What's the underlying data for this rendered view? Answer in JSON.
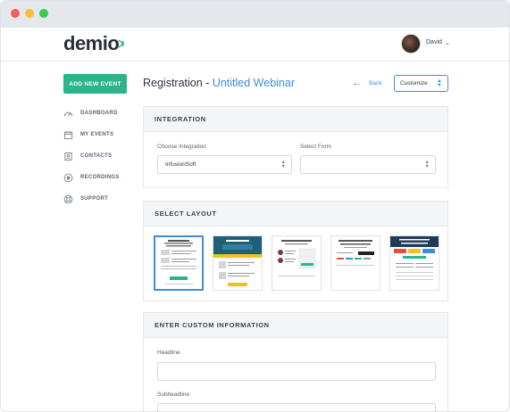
{
  "header": {
    "logo": "demio",
    "user_name": "David"
  },
  "sidebar": {
    "add_button": "ADD NEW EVENT",
    "items": [
      {
        "label": "DASHBOARD",
        "icon": "gauge-icon"
      },
      {
        "label": "MY EVENTS",
        "icon": "calendar-icon"
      },
      {
        "label": "CONTACTS",
        "icon": "contacts-icon"
      },
      {
        "label": "RECORDINGS",
        "icon": "record-icon"
      },
      {
        "label": "SUPPORT",
        "icon": "lifebuoy-icon"
      }
    ]
  },
  "main": {
    "title_prefix": "Registration - ",
    "title_accent": "Untitled Webinar",
    "back_label": "Back",
    "customize_label": "Customize",
    "integration": {
      "heading": "INTEGRATION",
      "choose_label": "Choose Integration",
      "choose_value": "InfusionSoft",
      "form_label": "Select Form",
      "form_value": ""
    },
    "layout": {
      "heading": "SELECT LAYOUT",
      "thumbnails": [
        "layout-1",
        "layout-2",
        "layout-3",
        "layout-4",
        "layout-5"
      ],
      "selected_index": 0
    },
    "custom_info": {
      "heading": "ENTER CUSTOM INFORMATION",
      "headline_label": "Headline",
      "subheadline_label": "Subheadline"
    }
  },
  "colors": {
    "accent": "#3b8dde",
    "brand_green": "#2cb58a"
  }
}
